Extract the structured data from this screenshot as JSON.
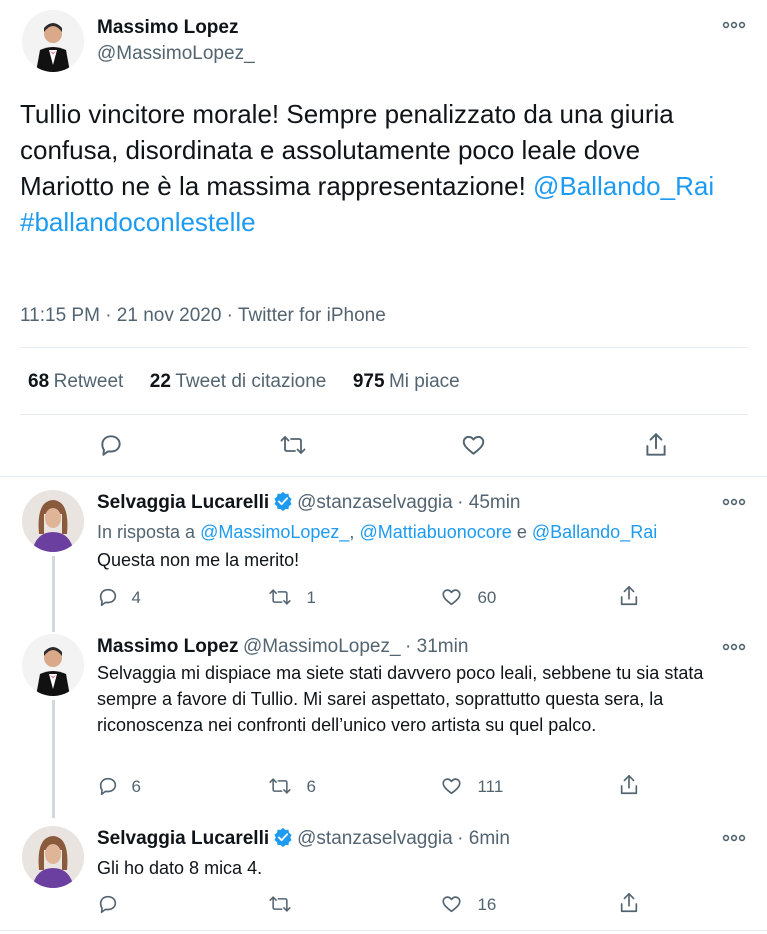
{
  "main_tweet": {
    "author_name": "Massimo Lopez",
    "author_handle": "@MassimoLopez_",
    "text_before": "Tullio vincitore morale! Sempre penalizzato da una giuria confusa, disordinata e assolutamente poco leale dove Mariotto ne è la massima rappresentazione!",
    "mention": "@Ballando_Rai",
    "hashtag": "#ballandoconlestelle",
    "meta": "11:15 PM · 21 nov 2020 · Twitter for iPhone",
    "stats": {
      "retweets_num": "68",
      "retweets_label": "Retweet",
      "quotes_num": "22",
      "quotes_label": "Tweet di citazione",
      "likes_num": "975",
      "likes_label": "Mi piace"
    }
  },
  "replies": [
    {
      "author_name": "Selvaggia Lucarelli",
      "verified": true,
      "author_handle": "@stanzaselvaggia",
      "time": "· 45min",
      "reply_to_prefix": "In risposta a",
      "reply_to_1": "@MassimoLopez_",
      "reply_to_sep1": ",",
      "reply_to_2": "@Mattiabuonocore",
      "reply_to_sep2": "e",
      "reply_to_3": "@Ballando_Rai",
      "text": "Questa non me la merito!",
      "replies_count": "4",
      "retweets_count": "1",
      "likes_count": "60"
    },
    {
      "author_name": "Massimo Lopez",
      "author_handle": "@MassimoLopez_",
      "time": "· 31min",
      "text": "Selvaggia mi dispiace ma siete stati davvero poco leali, sebbene tu sia stata sempre a favore di Tullio. Mi sarei aspettato, soprattutto questa sera, la riconoscenza nei confronti dell’unico vero artista su quel palco.",
      "replies_count": "6",
      "retweets_count": "6",
      "likes_count": "111"
    },
    {
      "author_name": "Selvaggia Lucarelli",
      "verified": true,
      "author_handle": "@stanzaselvaggia",
      "time": "· 6min",
      "text": "Gli ho dato 8 mica 4.",
      "replies_count": "",
      "retweets_count": "",
      "likes_count": "16"
    }
  ],
  "icons": {
    "more": "more-icon",
    "reply": "reply-icon",
    "retweet": "retweet-icon",
    "like": "like-icon",
    "share": "share-icon",
    "verified": "verified-badge-icon"
  },
  "colors": {
    "link": "#1d9bf0",
    "muted": "#536471",
    "text": "#0f1419",
    "divider": "#e6ecf0"
  }
}
